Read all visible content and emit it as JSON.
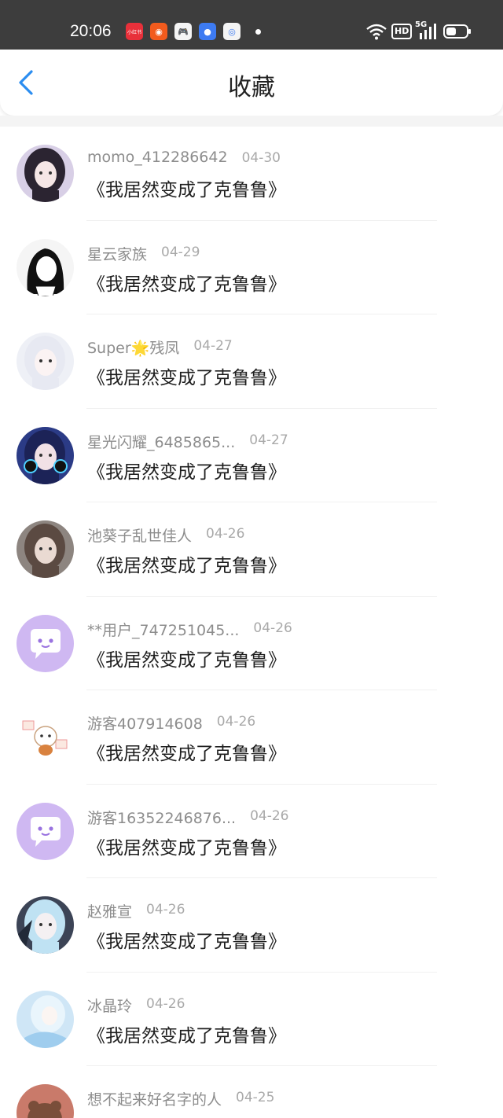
{
  "status_bar": {
    "time": "20:06",
    "app_icons": [
      {
        "name": "xiaohongshu-icon",
        "color": "#e8303a",
        "glyph": "小红书"
      },
      {
        "name": "kuaishou-icon",
        "color": "#f25b1d",
        "glyph": "◉"
      },
      {
        "name": "game-center-icon",
        "color": "#f4f4f4",
        "glyph": "🎮"
      },
      {
        "name": "message-app-icon",
        "color": "#3d7bf2",
        "glyph": "●"
      },
      {
        "name": "browser-app-icon",
        "color": "#f4f4f4",
        "glyph": "◎"
      }
    ],
    "hd_label": "HD",
    "network_label": "5G"
  },
  "header": {
    "title": "收藏",
    "back_color": "#2b8df0"
  },
  "items": [
    {
      "user": "momo_412286642",
      "date": "04-30",
      "content": "《我居然变成了克鲁鲁》",
      "avatar": "anime-girl-dark-hair"
    },
    {
      "user": "星云家族",
      "date": "04-29",
      "content": "《我居然变成了克鲁鲁》",
      "avatar": "anime-girl-sketch"
    },
    {
      "user": "Super🌟残凤",
      "date": "04-27",
      "content": "《我居然变成了克鲁鲁》",
      "avatar": "anime-boy-white-hair"
    },
    {
      "user": "星光闪耀_6485865...",
      "date": "04-27",
      "content": "《我居然变成了克鲁鲁》",
      "avatar": "anime-boy-headphones"
    },
    {
      "user": "池葵子乱世佳人",
      "date": "04-26",
      "content": "《我居然变成了克鲁鲁》",
      "avatar": "anime-girl-brown"
    },
    {
      "user": "**用户_747251045...",
      "date": "04-26",
      "content": "《我居然变成了克鲁鲁》",
      "avatar": "default-chat"
    },
    {
      "user": "游客407914608",
      "date": "04-26",
      "content": "《我居然变成了克鲁鲁》",
      "avatar": "cartoon-dog"
    },
    {
      "user": "游客16352246876...",
      "date": "04-26",
      "content": "《我居然变成了克鲁鲁》",
      "avatar": "default-chat"
    },
    {
      "user": "赵雅宣",
      "date": "04-26",
      "content": "《我居然变成了克鲁鲁》",
      "avatar": "anime-girl-blue"
    },
    {
      "user": "冰晶玲",
      "date": "04-26",
      "content": "《我居然变成了克鲁鲁》",
      "avatar": "anime-girl-ice"
    },
    {
      "user": "想不起来好名字的人",
      "date": "04-25",
      "content": "",
      "avatar": "cartoon-bear"
    }
  ]
}
